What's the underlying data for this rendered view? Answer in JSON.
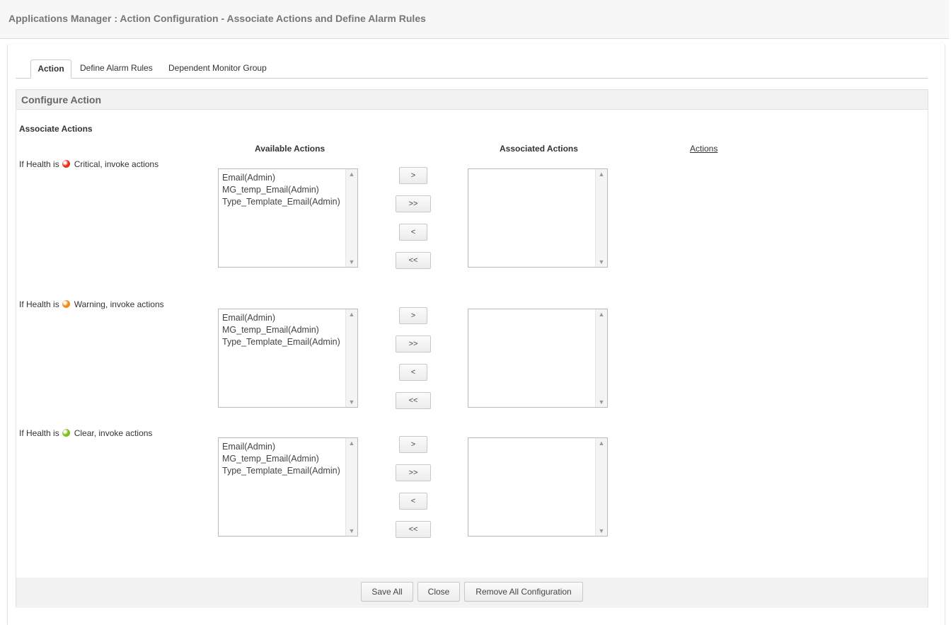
{
  "header": {
    "title": "Applications Manager : Action Configuration - Associate Actions and Define Alarm Rules"
  },
  "tabs": [
    {
      "label": "Action"
    },
    {
      "label": "Define Alarm Rules"
    },
    {
      "label": "Dependent Monitor Group"
    }
  ],
  "section": {
    "title": "Configure Action",
    "subtitle": "Associate Actions"
  },
  "columns": {
    "available": "Available Actions",
    "associated": "Associated Actions",
    "actions_link": "Actions"
  },
  "rows": [
    {
      "prefix": "If Health is",
      "status": "Critical, invoke actions",
      "dot_color": "#e8301c",
      "available": [
        "Email(Admin)",
        "MG_temp_Email(Admin)",
        "Type_Template_Email(Admin)"
      ],
      "associated": []
    },
    {
      "prefix": "If Health is",
      "status": "Warning, invoke actions",
      "dot_color": "#f08a1c",
      "available": [
        "Email(Admin)",
        "MG_temp_Email(Admin)",
        "Type_Template_Email(Admin)"
      ],
      "associated": []
    },
    {
      "prefix": "If Health is",
      "status": "Clear, invoke actions",
      "dot_color": "#7dc11c",
      "available": [
        "Email(Admin)",
        "MG_temp_Email(Admin)",
        "Type_Template_Email(Admin)"
      ],
      "associated": []
    }
  ],
  "move_buttons": {
    "add": ">",
    "add_all": ">>",
    "remove": "<",
    "remove_all": "<<"
  },
  "footer": {
    "save": "Save All",
    "close": "Close",
    "remove_all": "Remove All Configuration"
  }
}
